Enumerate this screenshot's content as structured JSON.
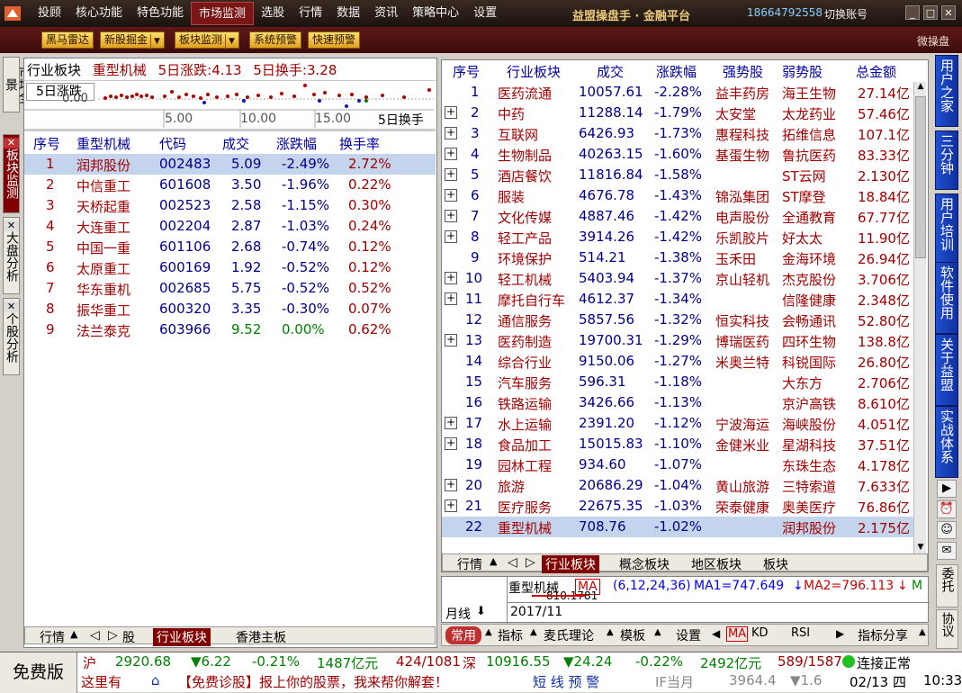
{
  "topbar": {
    "menu": [
      "投顾",
      "核心功能",
      "特色功能",
      "市场监测",
      "选股",
      "行情",
      "数据",
      "资讯",
      "策略中心",
      "设置"
    ],
    "active_menu": "市场监测",
    "brand": "益盟操盘手 · 金融平台",
    "phone": "18664792558",
    "switch_account": "切换账号",
    "window_buttons": [
      "minimize-icon",
      "maximize-icon",
      "close-icon"
    ]
  },
  "toolbar": {
    "buttons": [
      "黑马雷达",
      "新股掘金",
      "板块监测",
      "系统预警",
      "快速预警"
    ],
    "weicaopan": "微操盘"
  },
  "left_tabs": [
    "市场全景",
    "板块监测",
    "大盘分析",
    "个股分析"
  ],
  "left_header": {
    "label": "行业板块",
    "sector": "重型机械",
    "rise5": "5日涨跌:4.13",
    "turn5": "5日换手:3.28"
  },
  "mini_chart": {
    "ylabel": "5日涨跌",
    "yval": "0.00",
    "xticks": [
      "5.00",
      "10.00",
      "15.00"
    ],
    "xlabel": "5日换手"
  },
  "left_table": {
    "headers": [
      "序号",
      "重型机械",
      "代码",
      "成交",
      "涨跌幅",
      "换手率"
    ],
    "rows": [
      {
        "no": "1",
        "name": "润邦股份",
        "code": "002483",
        "price": "5.09",
        "chg": "-2.49%",
        "turn": "2.72%"
      },
      {
        "no": "2",
        "name": "中信重工",
        "code": "601608",
        "price": "3.50",
        "chg": "-1.96%",
        "turn": "0.22%"
      },
      {
        "no": "3",
        "name": "天桥起重",
        "code": "002523",
        "price": "2.58",
        "chg": "-1.15%",
        "turn": "0.30%"
      },
      {
        "no": "4",
        "name": "大连重工",
        "code": "002204",
        "price": "2.87",
        "chg": "-1.03%",
        "turn": "0.24%"
      },
      {
        "no": "5",
        "name": "中国一重",
        "code": "601106",
        "price": "2.68",
        "chg": "-0.74%",
        "turn": "0.12%"
      },
      {
        "no": "6",
        "name": "太原重工",
        "code": "600169",
        "price": "1.92",
        "chg": "-0.52%",
        "turn": "0.12%"
      },
      {
        "no": "7",
        "name": "华东重机",
        "code": "002685",
        "price": "5.75",
        "chg": "-0.52%",
        "turn": "0.52%"
      },
      {
        "no": "8",
        "name": "振华重工",
        "code": "600320",
        "price": "3.35",
        "chg": "-0.30%",
        "turn": "0.07%"
      },
      {
        "no": "9",
        "name": "法兰泰克",
        "code": "603966",
        "price": "9.52",
        "chg": "0.00%",
        "turn": "0.62%"
      }
    ]
  },
  "left_bottom_tabs": [
    "行情",
    "股",
    "行业板块",
    "香港主板"
  ],
  "right_table": {
    "headers": [
      "序号",
      "行业板块",
      "成交",
      "涨跌幅",
      "强势股",
      "弱势股",
      "总金额"
    ],
    "rows": [
      {
        "no": "1",
        "name": "医药流通",
        "vol": "10057.61",
        "chg": "-2.28%",
        "strong": "益丰药房",
        "weak": "海王生物",
        "amt": "27.14亿",
        "plus": false
      },
      {
        "no": "2",
        "name": "中药",
        "vol": "11288.14",
        "chg": "-1.79%",
        "strong": "太安堂",
        "weak": "太龙药业",
        "amt": "57.46亿",
        "plus": true
      },
      {
        "no": "3",
        "name": "互联网",
        "vol": "6426.93",
        "chg": "-1.73%",
        "strong": "惠程科技",
        "weak": "拓维信息",
        "amt": "107.1亿",
        "plus": true
      },
      {
        "no": "4",
        "name": "生物制品",
        "vol": "40263.15",
        "chg": "-1.60%",
        "strong": "基蛋生物",
        "weak": "鲁抗医药",
        "amt": "83.33亿",
        "plus": true
      },
      {
        "no": "5",
        "name": "酒店餐饮",
        "vol": "11816.84",
        "chg": "-1.58%",
        "strong": "",
        "weak": "ST云网",
        "amt": "2.130亿",
        "plus": true
      },
      {
        "no": "6",
        "name": "服装",
        "vol": "4676.78",
        "chg": "-1.43%",
        "strong": "锦泓集团",
        "weak": "ST摩登",
        "amt": "18.84亿",
        "plus": true
      },
      {
        "no": "7",
        "name": "文化传媒",
        "vol": "4887.46",
        "chg": "-1.42%",
        "strong": "电声股份",
        "weak": "全通教育",
        "amt": "67.77亿",
        "plus": true
      },
      {
        "no": "8",
        "name": "轻工产品",
        "vol": "3914.26",
        "chg": "-1.42%",
        "strong": "乐凯胶片",
        "weak": "好太太",
        "amt": "11.90亿",
        "plus": true
      },
      {
        "no": "9",
        "name": "环境保护",
        "vol": "514.21",
        "chg": "-1.38%",
        "strong": "玉禾田",
        "weak": "金海环境",
        "amt": "26.94亿",
        "plus": false
      },
      {
        "no": "10",
        "name": "轻工机械",
        "vol": "5403.94",
        "chg": "-1.37%",
        "strong": "京山轻机",
        "weak": "杰克股份",
        "amt": "3.706亿",
        "plus": true
      },
      {
        "no": "11",
        "name": "摩托自行车",
        "vol": "4612.37",
        "chg": "-1.34%",
        "strong": "",
        "weak": "信隆健康",
        "amt": "2.348亿",
        "plus": true
      },
      {
        "no": "12",
        "name": "通信服务",
        "vol": "5857.56",
        "chg": "-1.32%",
        "strong": "恒实科技",
        "weak": "会畅通讯",
        "amt": "52.80亿",
        "plus": false
      },
      {
        "no": "13",
        "name": "医药制造",
        "vol": "19700.31",
        "chg": "-1.29%",
        "strong": "博瑞医药",
        "weak": "四环生物",
        "amt": "138.8亿",
        "plus": true
      },
      {
        "no": "14",
        "name": "综合行业",
        "vol": "9150.06",
        "chg": "-1.27%",
        "strong": "米奥兰特",
        "weak": "科锐国际",
        "amt": "26.80亿",
        "plus": false
      },
      {
        "no": "15",
        "name": "汽车服务",
        "vol": "596.31",
        "chg": "-1.18%",
        "strong": "",
        "weak": "大东方",
        "amt": "2.706亿",
        "plus": false
      },
      {
        "no": "16",
        "name": "铁路运输",
        "vol": "3426.66",
        "chg": "-1.13%",
        "strong": "",
        "weak": "京沪高铁",
        "amt": "8.610亿",
        "plus": false
      },
      {
        "no": "17",
        "name": "水上运输",
        "vol": "2391.20",
        "chg": "-1.12%",
        "strong": "宁波海运",
        "weak": "海峡股份",
        "amt": "4.051亿",
        "plus": true
      },
      {
        "no": "18",
        "name": "食品加工",
        "vol": "15015.83",
        "chg": "-1.10%",
        "strong": "金健米业",
        "weak": "星湖科技",
        "amt": "37.51亿",
        "plus": true
      },
      {
        "no": "19",
        "name": "园林工程",
        "vol": "934.60",
        "chg": "-1.07%",
        "strong": "",
        "weak": "东珠生态",
        "amt": "4.178亿",
        "plus": false
      },
      {
        "no": "20",
        "name": "旅游",
        "vol": "20686.29",
        "chg": "-1.04%",
        "strong": "黄山旅游",
        "weak": "三特索道",
        "amt": "7.633亿",
        "plus": true
      },
      {
        "no": "21",
        "name": "医疗服务",
        "vol": "22675.35",
        "chg": "-1.03%",
        "strong": "荣泰健康",
        "weak": "奥美医疗",
        "amt": "76.86亿",
        "plus": true
      },
      {
        "no": "22",
        "name": "重型机械",
        "vol": "708.76",
        "chg": "-1.02%",
        "strong": "",
        "weak": "润邦股份",
        "amt": "2.175亿",
        "plus": false
      }
    ]
  },
  "right_bottom_tabs": [
    "行情",
    "行业板块",
    "概念板块",
    "地区板块",
    "板块"
  ],
  "kline": {
    "name": "重型机械",
    "ma_button": "MA",
    "params": "(6,12,24,36)",
    "ma1": "MA1=747.649",
    "ma2": "MA2=796.113",
    "ma3": "M",
    "mini_text": "810.1781",
    "period": "月线",
    "date": "2017/11"
  },
  "bottom_toolbar": [
    "常用",
    "指标",
    "麦氏理论",
    "模板",
    "设置",
    "MA",
    "KD",
    "RSI",
    "指标分享"
  ],
  "right_sidebar": [
    "用户之家",
    "三分钟",
    "用户培训",
    "软件使用",
    "关于益盟",
    "实战体系"
  ],
  "right_sidebar_icons": [
    "video-icon",
    "alarm-icon",
    "person-icon",
    "chat-icon"
  ],
  "right_sidebar_lower": [
    "委托",
    "协议"
  ],
  "status": {
    "free": "免费版",
    "sh_label": "沪",
    "sh_index": "2920.68",
    "sh_change": "▼6.22",
    "sh_pct": "-0.21%",
    "sh_amt": "1487亿元",
    "sh_ratio": "424/1081",
    "sz_label": "深",
    "sz_index": "10916.55",
    "sz_change": "▼24.24",
    "sz_pct": "-0.22%",
    "sz_amt": "2492亿元",
    "sz_ratio": "589/1587",
    "conn": "连接正常",
    "marquee_left": "这里有",
    "marquee": "【免费诊股】报上你的股票，我来帮你解套！",
    "alert": "短 线 预 警",
    "if_label": "IF当月",
    "if_value": "3964.4",
    "if_change": "▼1.6",
    "date": "02/13 四",
    "time": "10:33"
  },
  "colors": {
    "accent": "#800000",
    "up": "#a00000",
    "down": "#008000",
    "blue": "#1030a0"
  }
}
